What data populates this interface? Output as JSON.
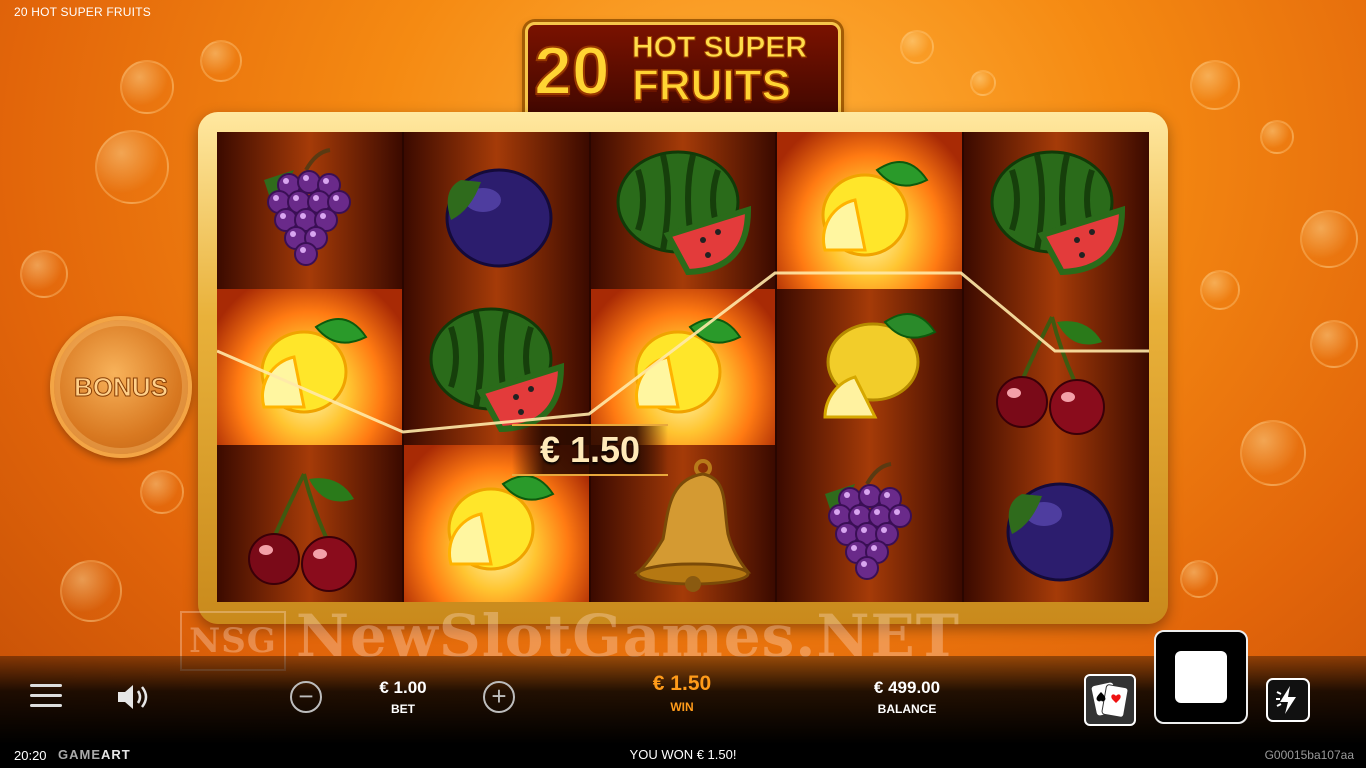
{
  "game": {
    "title": "20 HOT SUPER FRUITS"
  },
  "logo": {
    "number": "20",
    "line1": "HOT SUPER",
    "line2": "FRUITS"
  },
  "reels": [
    [
      "grapes",
      "hot-lemon",
      "cherries"
    ],
    [
      "plum",
      "watermelon",
      "hot-lemon"
    ],
    [
      "watermelon",
      "hot-lemon",
      "bell"
    ],
    [
      "hot-lemon",
      "lemon",
      "grapes"
    ],
    [
      "watermelon",
      "cherries",
      "plum"
    ]
  ],
  "win_badge": "€ 1.50",
  "bonus": {
    "label": "BONUS"
  },
  "watermark": {
    "mark": "NSG",
    "text": "NewSlotGames.NET"
  },
  "controls": {
    "bet": {
      "value": "€ 1.00",
      "label": "BET"
    },
    "win": {
      "value": "€ 1.50",
      "label": "WIN"
    },
    "balance": {
      "value": "€ 499.00",
      "label": "BALANCE"
    },
    "minus": "−",
    "plus": "+"
  },
  "status": {
    "clock": "20:20",
    "brand_a": "GAME",
    "brand_b": "ART",
    "message": "YOU WON € 1.50!",
    "game_id": "G00015ba107aa"
  },
  "colors": {
    "accent": "#ff9b1a",
    "frame": "#e9b13a",
    "background": "#f58a12"
  }
}
